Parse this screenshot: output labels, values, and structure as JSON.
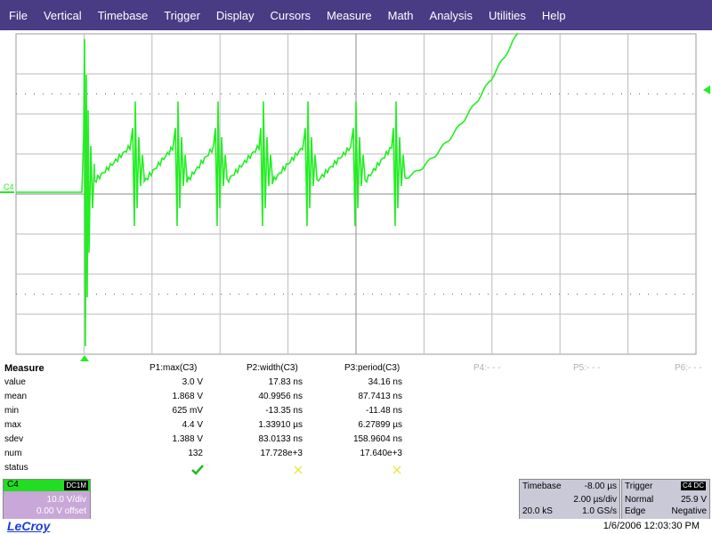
{
  "menu": [
    "File",
    "Vertical",
    "Timebase",
    "Trigger",
    "Display",
    "Cursors",
    "Measure",
    "Math",
    "Analysis",
    "Utilities",
    "Help"
  ],
  "channel_marker": "C4",
  "trace_color": "#22ee22",
  "measure": {
    "title": "Measure",
    "params": [
      "P1:max(C3)",
      "P2:width(C3)",
      "P3:period(C3)",
      "P4:- - -",
      "P5:- - -",
      "P6:- - -"
    ],
    "rows": [
      {
        "label": "value",
        "cells": [
          "3.0 V",
          "17.83 ns",
          "34.16 ns"
        ]
      },
      {
        "label": "mean",
        "cells": [
          "1.868 V",
          "40.9956 ns",
          "87.7413 ns"
        ]
      },
      {
        "label": "min",
        "cells": [
          "625 mV",
          "-13.35 ns",
          "-11.48 ns"
        ]
      },
      {
        "label": "max",
        "cells": [
          "4.4 V",
          "1.33910 µs",
          "6.27899 µs"
        ]
      },
      {
        "label": "sdev",
        "cells": [
          "1.388 V",
          "83.0133 ns",
          "158.9604 ns"
        ]
      },
      {
        "label": "num",
        "cells": [
          "132",
          "17.728e+3",
          "17.640e+3"
        ]
      }
    ],
    "status_label": "status",
    "status": [
      "check-icon",
      "cross-icon",
      "cross-icon"
    ]
  },
  "channel_box": {
    "name": "C4",
    "coupling": "DC1M",
    "vdiv": "10.0 V/div",
    "offset": "0.00 V offset"
  },
  "timebase": {
    "title": "Timebase",
    "delay": "-8.00 µs",
    "per_div": "2.00 µs/div",
    "samples": "20.0 kS",
    "rate": "1.0 GS/s"
  },
  "trigger": {
    "title": "Trigger",
    "badge": "C4 DC",
    "mode": "Normal",
    "level": "25.9 V",
    "type": "Edge",
    "slope": "Negative"
  },
  "footer": {
    "logo": "LeCroy",
    "datetime": "1/6/2006 12:03:30 PM"
  }
}
